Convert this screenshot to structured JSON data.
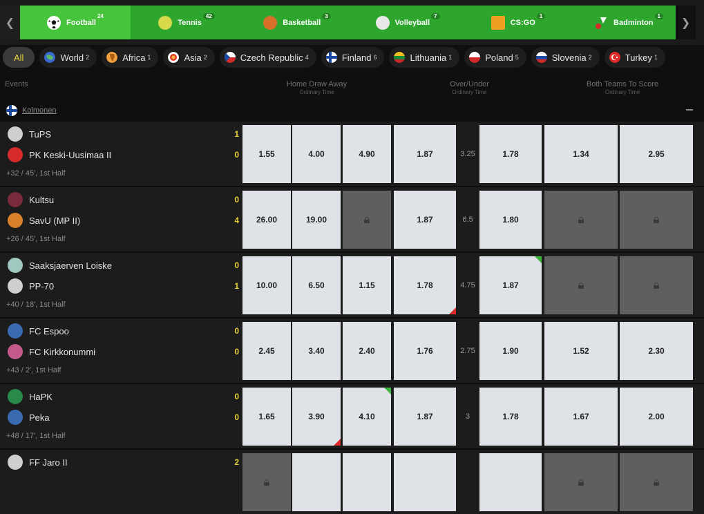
{
  "sports": [
    {
      "name": "Football",
      "count": "24",
      "active": true,
      "icon": "football-icon",
      "color": "#ffffff"
    },
    {
      "name": "Tennis",
      "count": "42",
      "active": false,
      "icon": "tennis-ball-icon",
      "color": "#d8d84a"
    },
    {
      "name": "Basketball",
      "count": "3",
      "active": false,
      "icon": "basketball-icon",
      "color": "#d9702a"
    },
    {
      "name": "Volleyball",
      "count": "7",
      "active": false,
      "icon": "volleyball-icon",
      "color": "#e8e8e8"
    },
    {
      "name": "CS:GO",
      "count": "1",
      "active": false,
      "icon": "csgo-icon",
      "color": "#f0a020"
    },
    {
      "name": "Badminton",
      "count": "1",
      "active": false,
      "icon": "shuttlecock-icon",
      "color": "#ffffff"
    }
  ],
  "filters": [
    {
      "label": "All",
      "count": "",
      "flag": "none"
    },
    {
      "label": "World",
      "count": "2",
      "flag": "world"
    },
    {
      "label": "Africa",
      "count": "1",
      "flag": "africa"
    },
    {
      "label": "Asia",
      "count": "2",
      "flag": "asia"
    },
    {
      "label": "Czech Republic",
      "count": "4",
      "flag": "cz"
    },
    {
      "label": "Finland",
      "count": "6",
      "flag": "fi"
    },
    {
      "label": "Lithuania",
      "count": "1",
      "flag": "lt"
    },
    {
      "label": "Poland",
      "count": "5",
      "flag": "pl"
    },
    {
      "label": "Slovenia",
      "count": "2",
      "flag": "si"
    },
    {
      "label": "Turkey",
      "count": "1",
      "flag": "tr"
    }
  ],
  "headers": {
    "events": "Events",
    "hda": "Home Draw Away",
    "hda_sub": "Ordinary Time",
    "ou": "Over/Under",
    "ou_sub": "Ordinary Time",
    "btts": "Both Teams To Score",
    "btts_sub": "Ordinary Time"
  },
  "league": {
    "name": "Kolmonen",
    "flag": "fi"
  },
  "events": [
    {
      "home": "TuPS",
      "away": "PK Keski-Uusimaa II",
      "home_score": "1",
      "away_score": "0",
      "status": "+32 / 45', 1st Half",
      "home_logo": "#cfcfcf",
      "away_logo": "#d42a2a",
      "odds": [
        "1.55",
        "4.00",
        "4.90",
        "1.87",
        "1.78",
        "1.34",
        "2.95"
      ],
      "line": "3.25",
      "locked": [],
      "up": [],
      "down": []
    },
    {
      "home": "Kultsu",
      "away": "SavU (MP II)",
      "home_score": "0",
      "away_score": "4",
      "status": "+26 / 45', 1st Half",
      "home_logo": "#7a2a3a",
      "away_logo": "#d9802a",
      "odds": [
        "26.00",
        "19.00",
        "",
        "1.87",
        "1.80",
        "",
        ""
      ],
      "line": "6.5",
      "locked": [
        2,
        5,
        6
      ],
      "up": [],
      "down": []
    },
    {
      "home": "Saaksjaerven Loiske",
      "away": "PP-70",
      "home_score": "0",
      "away_score": "1",
      "status": "+40 / 18', 1st Half",
      "home_logo": "#9fc8c0",
      "away_logo": "#cfcfcf",
      "odds": [
        "10.00",
        "6.50",
        "1.15",
        "1.78",
        "1.87",
        "",
        ""
      ],
      "line": "4.75",
      "locked": [
        5,
        6
      ],
      "up": [
        4
      ],
      "down": [
        3
      ]
    },
    {
      "home": "FC Espoo",
      "away": "FC Kirkkonummi",
      "home_score": "0",
      "away_score": "0",
      "status": "+43 / 2', 1st Half",
      "home_logo": "#3a6ab0",
      "away_logo": "#c45a8a",
      "odds": [
        "2.45",
        "3.40",
        "2.40",
        "1.76",
        "1.90",
        "1.52",
        "2.30"
      ],
      "line": "2.75",
      "locked": [],
      "up": [],
      "down": []
    },
    {
      "home": "HaPK",
      "away": "Peka",
      "home_score": "0",
      "away_score": "0",
      "status": "+48 / 17', 1st Half",
      "home_logo": "#2a8a4a",
      "away_logo": "#3a6ab0",
      "odds": [
        "1.65",
        "3.90",
        "4.10",
        "1.87",
        "1.78",
        "1.67",
        "2.00"
      ],
      "line": "3",
      "locked": [],
      "up": [
        2
      ],
      "down": [
        1
      ]
    },
    {
      "home": "FF Jaro II",
      "away": "",
      "home_score": "2",
      "away_score": "",
      "status": "",
      "home_logo": "#cfcfcf",
      "away_logo": "#cfcfcf",
      "odds": [
        "",
        "",
        "",
        "",
        "",
        "",
        ""
      ],
      "line": "",
      "locked": [
        0,
        5,
        6
      ],
      "up": [],
      "down": []
    }
  ]
}
